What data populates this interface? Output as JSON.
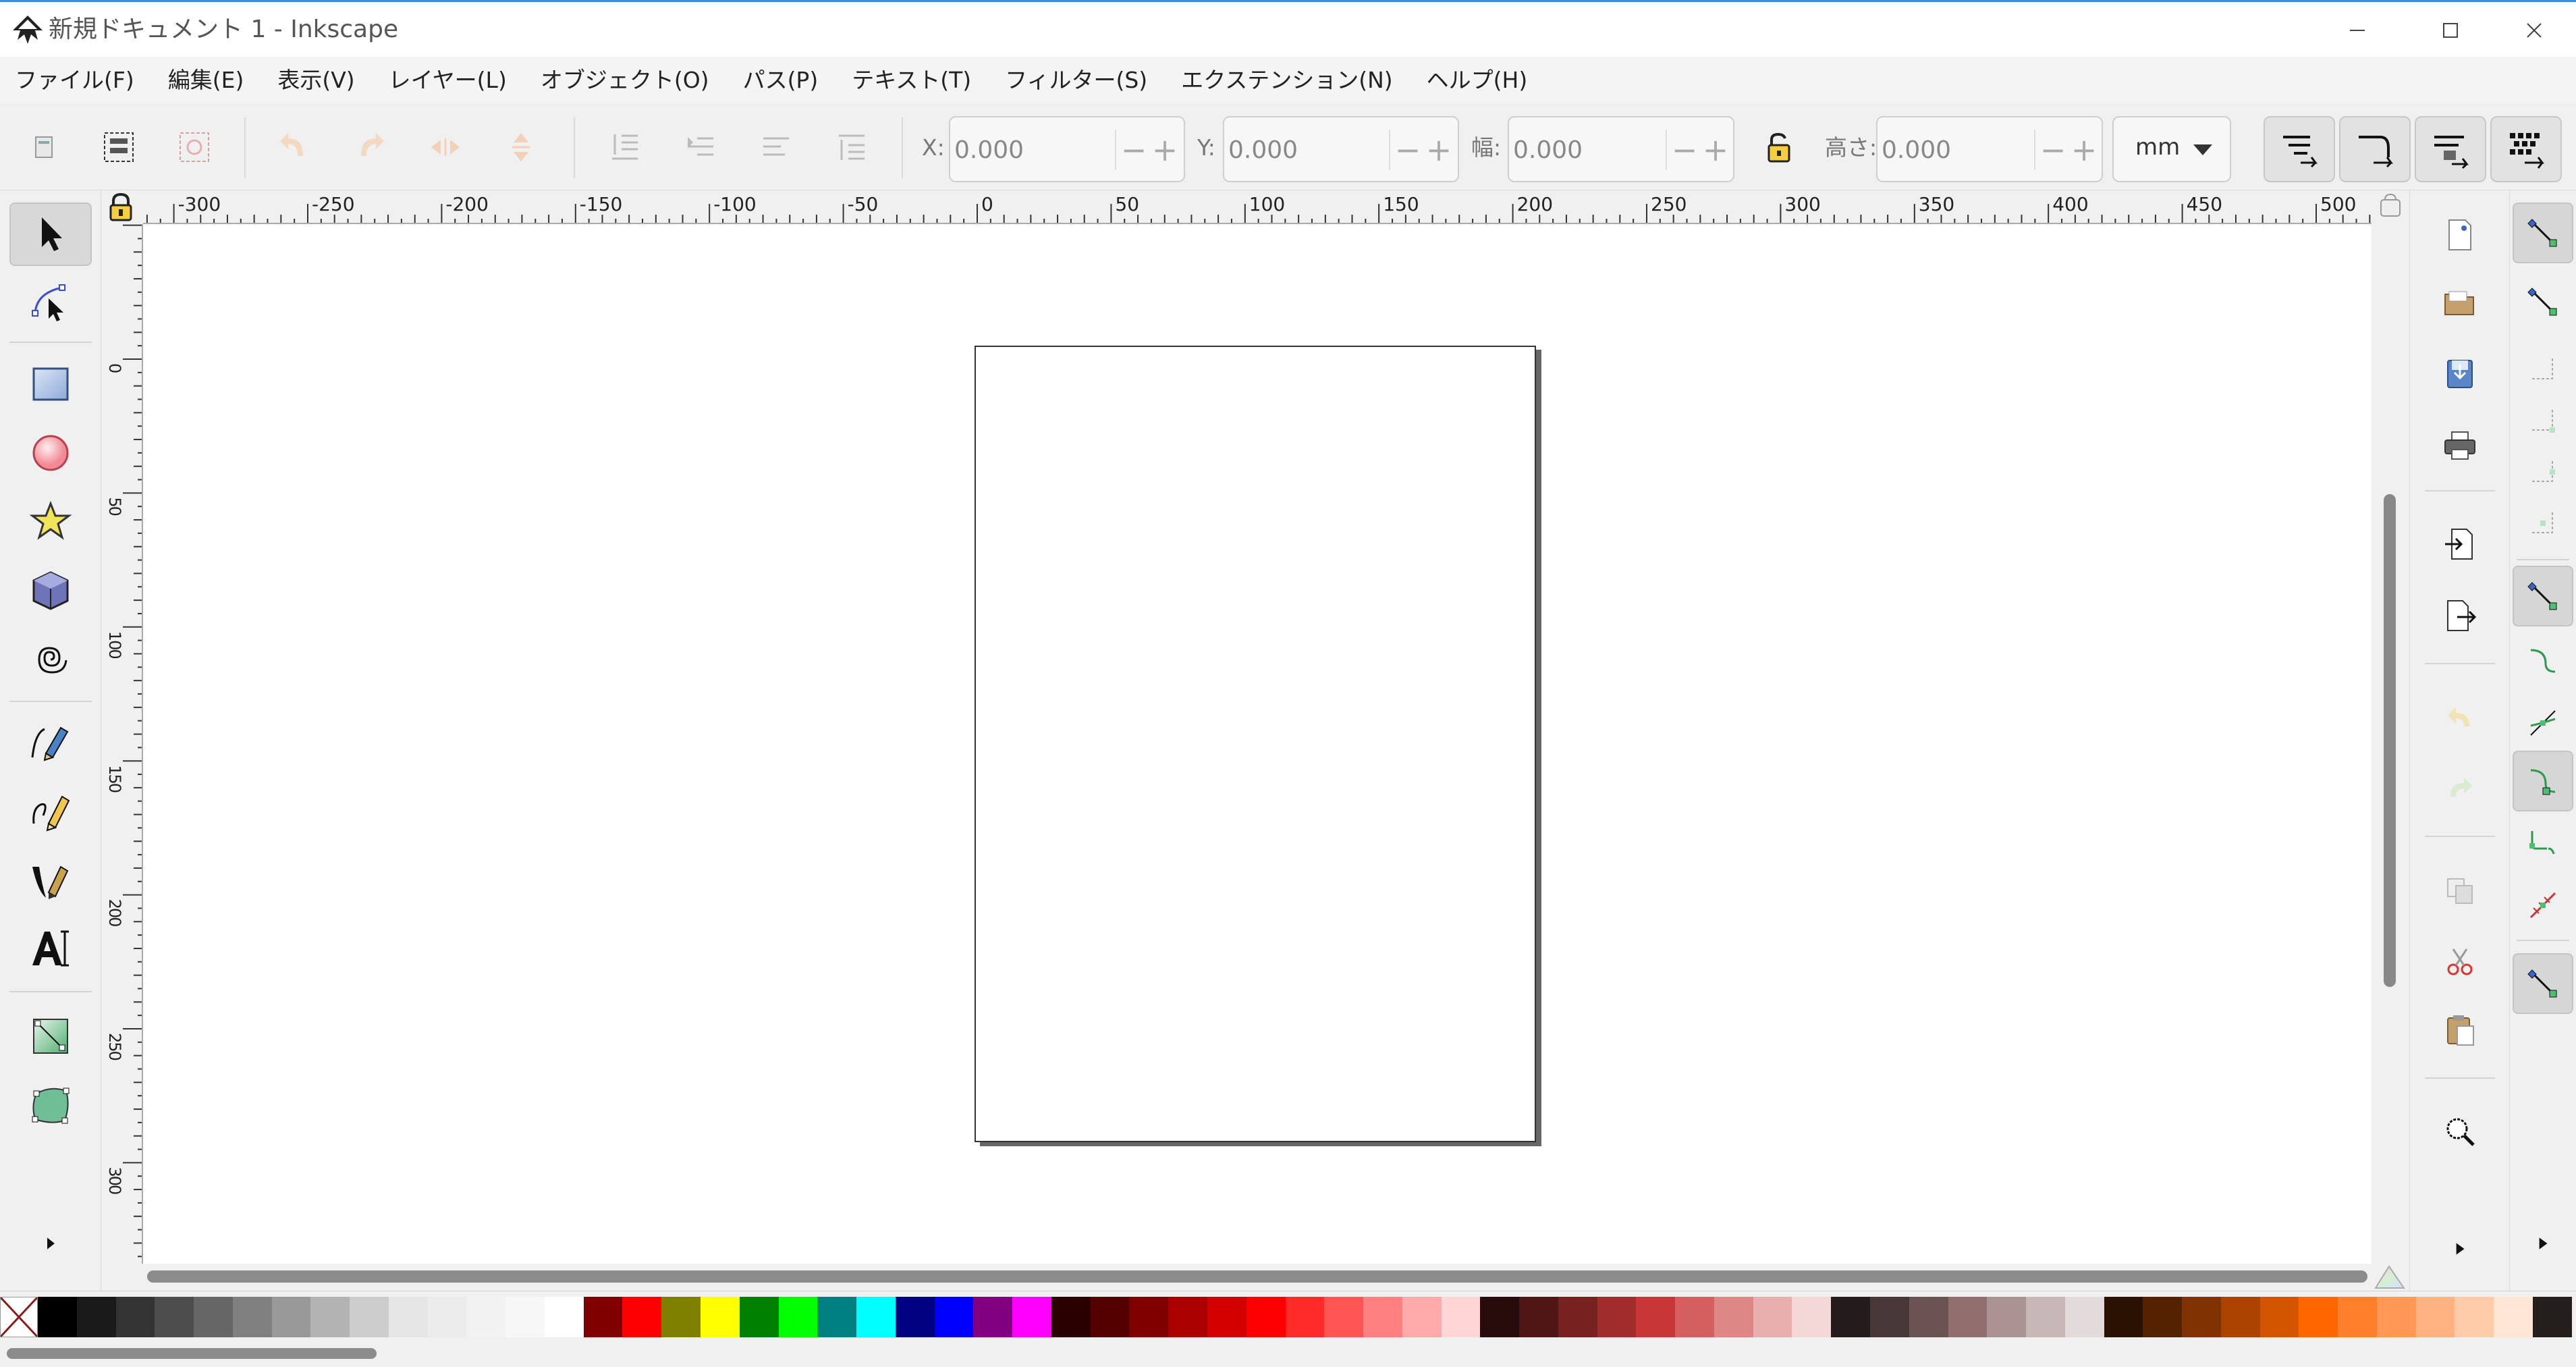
{
  "window": {
    "title": "新規ドキュメント 1 - Inkscape",
    "buttons": [
      "minimize",
      "maximize",
      "close"
    ]
  },
  "menu": [
    "ファイル(F)",
    "編集(E)",
    "表示(V)",
    "レイヤー(L)",
    "オブジェクト(O)",
    "パス(P)",
    "テキスト(T)",
    "フィルター(S)",
    "エクステンション(N)",
    "ヘルプ(H)"
  ],
  "tool_controls": {
    "x_label": "X:",
    "x_value": "0.000",
    "y_label": "Y:",
    "y_value": "0.000",
    "w_label": "幅:",
    "w_value": "0.000",
    "h_label": "高さ:",
    "h_value": "0.000",
    "unit": "mm",
    "minus": "−",
    "plus": "+"
  },
  "ruler": {
    "h_labels": [
      "-300",
      "-250",
      "-200",
      "-150",
      "-100",
      "-50",
      "0",
      "50",
      "100",
      "150",
      "200",
      "250",
      "300",
      "350",
      "400",
      "450",
      "500"
    ],
    "v_labels": [
      "0",
      "50",
      "100",
      "150",
      "200",
      "250",
      "300"
    ]
  },
  "tools": [
    {
      "name": "selector-tool",
      "icon": "arrow-icon",
      "active": true
    },
    {
      "name": "node-tool",
      "icon": "node-icon"
    },
    {
      "name": "rectangle-tool",
      "icon": "rectangle-icon"
    },
    {
      "name": "ellipse-tool",
      "icon": "circle-icon"
    },
    {
      "name": "star-tool",
      "icon": "star-icon"
    },
    {
      "name": "3dbox-tool",
      "icon": "cube-icon"
    },
    {
      "name": "spiral-tool",
      "icon": "spiral-icon"
    },
    {
      "name": "pen-tool",
      "icon": "pen-icon"
    },
    {
      "name": "pencil-tool",
      "icon": "pencil-icon"
    },
    {
      "name": "calligraphy-tool",
      "icon": "calligraphy-icon"
    },
    {
      "name": "text-tool",
      "icon": "text-icon"
    },
    {
      "name": "gradient-tool",
      "icon": "gradient-icon"
    },
    {
      "name": "mesh-tool",
      "icon": "mesh-icon"
    }
  ],
  "palette": {
    "colors": [
      "#000000",
      "#1a1a1a",
      "#333333",
      "#4d4d4d",
      "#666666",
      "#808080",
      "#999999",
      "#b3b3b3",
      "#cccccc",
      "#e6e6e6",
      "#ececec",
      "#f2f2f2",
      "#f7f7f7",
      "#ffffff",
      "#800000",
      "#ff0000",
      "#808000",
      "#ffff00",
      "#008000",
      "#00ff00",
      "#008080",
      "#00ffff",
      "#000080",
      "#0000ff",
      "#800080",
      "#ff00ff",
      "#2b0000",
      "#550000",
      "#800000",
      "#aa0000",
      "#d40000",
      "#ff0000",
      "#ff2a2a",
      "#ff5555",
      "#ff8080",
      "#ffaaaa",
      "#ffd5d5",
      "#280b0b",
      "#501616",
      "#782121",
      "#a02c2c",
      "#c83737",
      "#d35f5f",
      "#de8787",
      "#e9afaf",
      "#f4d7d7",
      "#241c1c",
      "#483737",
      "#6c5353",
      "#916f6f",
      "#ac9393",
      "#c8b7b7",
      "#e3dbdb",
      "#2b1100",
      "#552200",
      "#803300",
      "#aa4400",
      "#d45500",
      "#ff6600",
      "#ff7f2a",
      "#ff9955",
      "#ffb380",
      "#ffccaa",
      "#ffe6d5",
      "#241f1c"
    ]
  }
}
